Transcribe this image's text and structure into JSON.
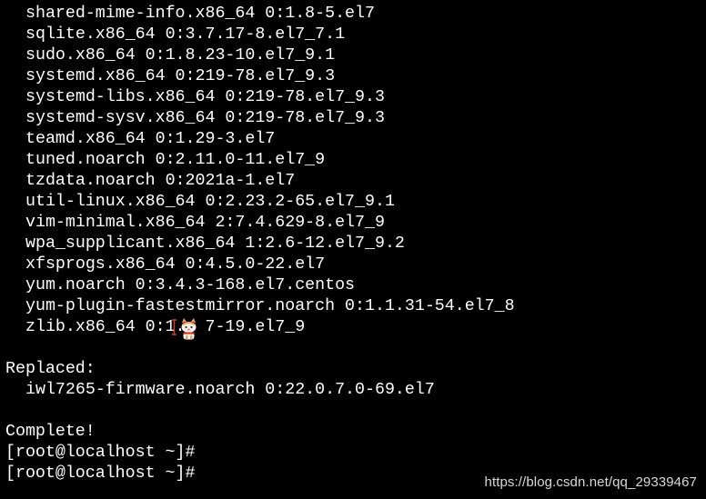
{
  "terminal": {
    "package_lines": [
      "shared-mime-info.x86_64 0:1.8-5.el7",
      "sqlite.x86_64 0:3.7.17-8.el7_7.1",
      "sudo.x86_64 0:1.8.23-10.el7_9.1",
      "systemd.x86_64 0:219-78.el7_9.3",
      "systemd-libs.x86_64 0:219-78.el7_9.3",
      "systemd-sysv.x86_64 0:219-78.el7_9.3",
      "teamd.x86_64 0:1.29-3.el7",
      "tuned.noarch 0:2.11.0-11.el7_9",
      "tzdata.noarch 0:2021a-1.el7",
      "util-linux.x86_64 0:2.23.2-65.el7_9.1",
      "vim-minimal.x86_64 2:7.4.629-8.el7_9",
      "wpa_supplicant.x86_64 1:2.6-12.el7_9.2",
      "xfsprogs.x86_64 0:4.5.0-22.el7",
      "yum.noarch 0:3.4.3-168.el7.centos",
      "yum-plugin-fastestmirror.noarch 0:1.1.31-54.el7_8",
      "zlib.x86_64 0:1.  7-19.el7_9"
    ],
    "replaced_header": "Replaced:",
    "replaced_line": "iwl7265-firmware.noarch 0:22.0.7.0-69.el7",
    "complete_text": "Complete!",
    "prompt_1": "[root@localhost ~]#",
    "prompt_2": "[root@localhost ~]#"
  },
  "watermark": "https://blog.csdn.net/qq_29339467",
  "icons": {
    "cursor": "text-cursor-icon",
    "mascot": "cat-mascot-icon"
  }
}
